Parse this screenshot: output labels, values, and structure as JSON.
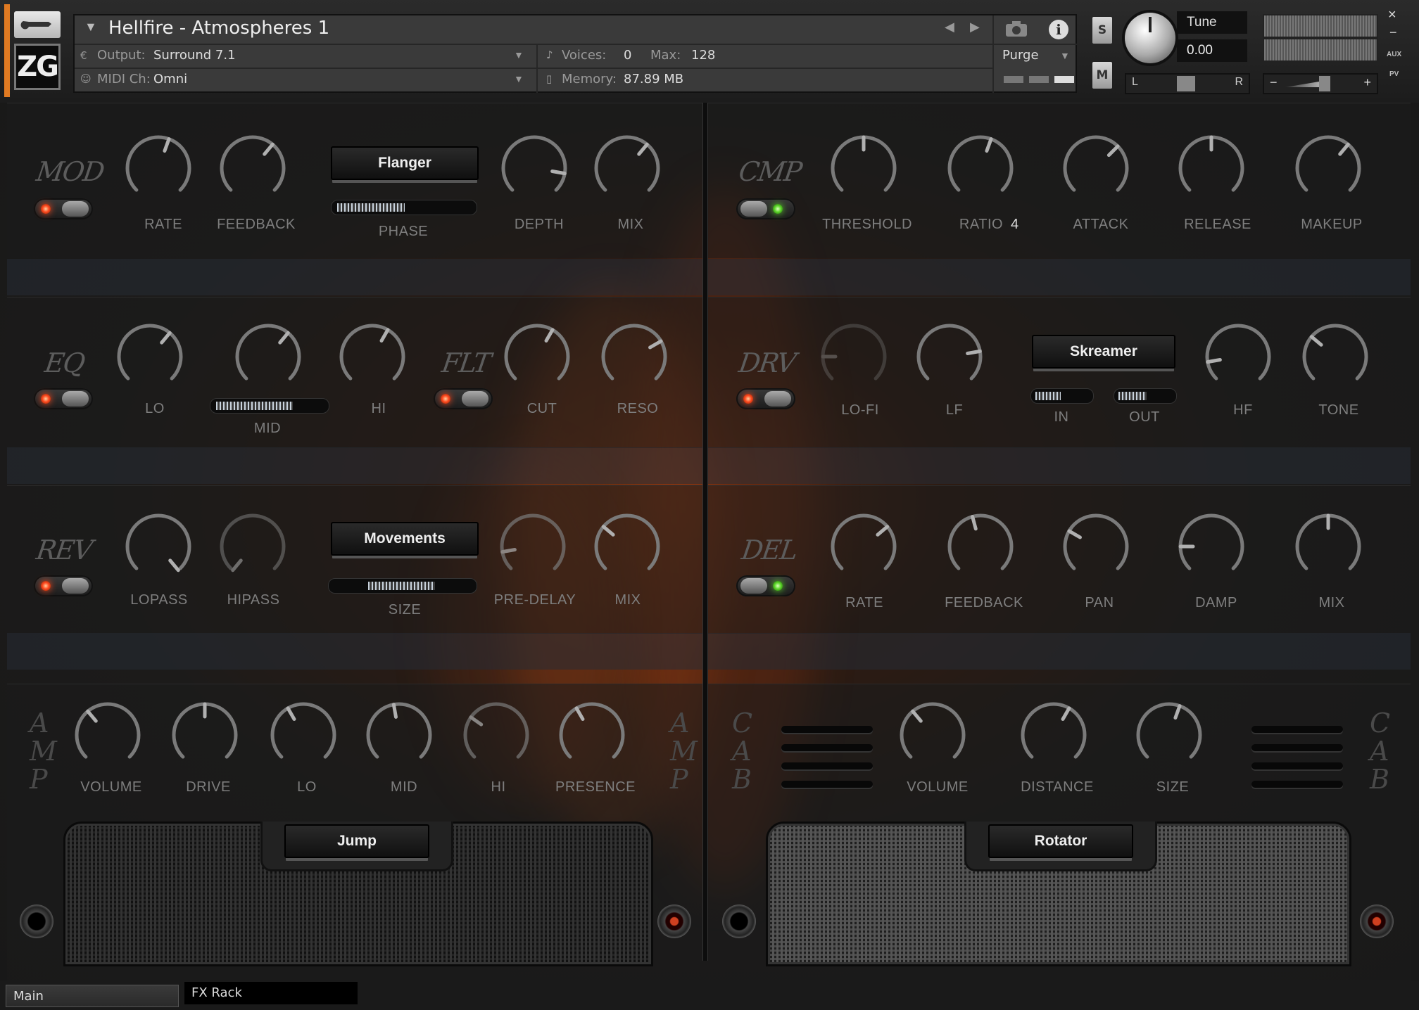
{
  "header": {
    "instrument_name": "Hellfire - Atmospheres 1",
    "output_label": "Output:",
    "output_value": "Surround 7.1",
    "midi_label": "MIDI Ch:",
    "midi_value": "Omni",
    "voices_label": "Voices:",
    "voices_value": "0",
    "max_label": "Max:",
    "max_value": "128",
    "memory_label": "Memory:",
    "memory_value": "87.89 MB",
    "purge_label": "Purge",
    "solo_label": "S",
    "mute_label": "M",
    "tune_label": "Tune",
    "tune_value": "0.00",
    "pan_left": "L",
    "pan_right": "R",
    "vol_minus": "−",
    "vol_plus": "+",
    "close": "×",
    "minimize": "−",
    "aux": "AUX",
    "pv": "PV",
    "logo": "ZG"
  },
  "mod": {
    "title": "MOD",
    "rate": "RATE",
    "feedback": "FEEDBACK",
    "type": "Flanger",
    "phase": "PHASE",
    "depth": "DEPTH",
    "mix": "MIX",
    "phase_level": 0.52
  },
  "cmp": {
    "title": "CMP",
    "threshold": "THRESHOLD",
    "ratio": "RATIO",
    "ratio_value": "4",
    "attack": "ATTACK",
    "release": "RELEASE",
    "makeup": "MAKEUP"
  },
  "eq": {
    "title": "EQ",
    "lo": "LO",
    "mid": "MID",
    "hi": "HI",
    "mid_level": 0.72
  },
  "flt": {
    "title": "FLT",
    "cut": "CUT",
    "reso": "RESO"
  },
  "drv": {
    "title": "DRV",
    "lofi": "LO-FI",
    "lf": "LF",
    "type": "Skreamer",
    "in": "IN",
    "out": "OUT",
    "hf": "HF",
    "tone": "TONE",
    "in_level": 0.45,
    "out_level": 0.5
  },
  "rev": {
    "title": "REV",
    "lopass": "LOPASS",
    "hipass": "HIPASS",
    "type": "Movements",
    "size": "SIZE",
    "predelay": "PRE-DELAY",
    "mix": "MIX",
    "size_level": 0.5
  },
  "del": {
    "title": "DEL",
    "rate": "RATE",
    "feedback": "FEEDBACK",
    "pan": "PAN",
    "damp": "DAMP",
    "mix": "MIX"
  },
  "amp": {
    "title": "AMP",
    "volume": "VOLUME",
    "drive": "DRIVE",
    "lo": "LO",
    "mid": "MID",
    "hi": "HI",
    "presence": "PRESENCE",
    "model": "Jump"
  },
  "cab": {
    "title": "CAB",
    "volume": "VOLUME",
    "distance": "DISTANCE",
    "size": "SIZE",
    "model": "Rotator"
  },
  "tabs": {
    "main": "Main",
    "fxrack": "FX Rack"
  }
}
